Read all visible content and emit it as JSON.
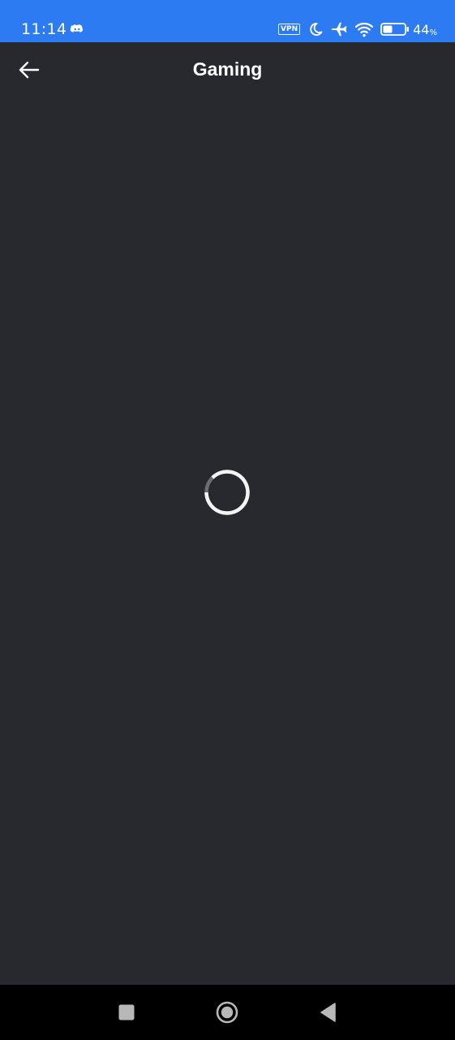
{
  "status_bar": {
    "time": "11:14",
    "app_icon": "discord-icon",
    "vpn_label": "VPN",
    "icons": [
      "do-not-disturb-moon-icon",
      "airplane-mode-icon",
      "wifi-icon",
      "battery-icon"
    ],
    "battery_value": "44",
    "battery_unit": "%",
    "battery_level": 0.44,
    "background_color": "#2c7bf2"
  },
  "header": {
    "back_icon": "arrow-left-icon",
    "title": "Gaming"
  },
  "content": {
    "state": "loading",
    "spinner_icon": "loading-spinner-icon",
    "background_color": "#28292e"
  },
  "nav_bar": {
    "buttons": [
      {
        "name": "recents-button",
        "icon": "square-icon"
      },
      {
        "name": "home-button",
        "icon": "circle-icon"
      },
      {
        "name": "back-nav-button",
        "icon": "triangle-back-icon"
      }
    ]
  }
}
